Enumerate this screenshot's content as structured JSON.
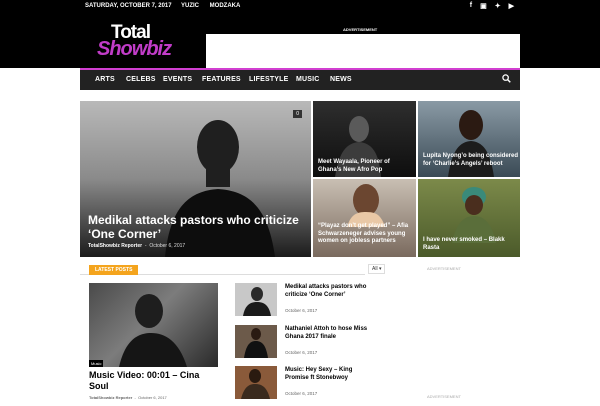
{
  "topbar": {
    "date": "SATURDAY, OCTOBER 7, 2017",
    "links": [
      "YUZIC",
      "MODZAKA"
    ],
    "social_icons": [
      "facebook-icon",
      "instagram-icon",
      "twitter-icon",
      "youtube-icon"
    ]
  },
  "header": {
    "logo_line1": "Total",
    "logo_line2": "Showbiz",
    "ad_label": "ADVERTISEMENT"
  },
  "nav": {
    "items": [
      "ARTS",
      "CELEBS",
      "EVENTS",
      "FEATURES",
      "LIFESTYLE",
      "MUSIC",
      "NEWS"
    ],
    "search_icon": "search-icon"
  },
  "hero": {
    "title": "Medikal attacks pastors who criticize ‘One Corner’",
    "author": "TotalShowbiz Reporter",
    "date": "October 6, 2017",
    "comment_count": "0"
  },
  "tiles": [
    {
      "caption": "Meet Wayaala, Pioneer of Ghana’s New Afro Pop"
    },
    {
      "caption": "Lupita Nyong’o being considered for ‘Charlie’s Angels’ reboot"
    },
    {
      "caption": "“Playaz don’t get played” – Afia Schwarzeneger advises young women on jobless partners"
    },
    {
      "caption": "I have never smoked – Blakk Rasta"
    }
  ],
  "latest": {
    "tag": "LATEST POSTS",
    "filter": "All",
    "side_ad_label": "ADVERTISEMENT",
    "feature": {
      "category": "Music",
      "title": "Music Video: 00:01 – Cina Soul",
      "author": "TotalShowbiz Reporter",
      "date": "October 6, 2017"
    },
    "items": [
      {
        "title": "Medikal attacks pastors who criticize ‘One Corner’",
        "date": "October 6, 2017"
      },
      {
        "title": "Nathaniel Attoh to hose Miss Ghana 2017 finale",
        "date": "October 6, 2017"
      },
      {
        "title": "Music: Hey Sexy – King Promise ft Stonebwoy",
        "date": "October 6, 2017"
      }
    ]
  }
}
